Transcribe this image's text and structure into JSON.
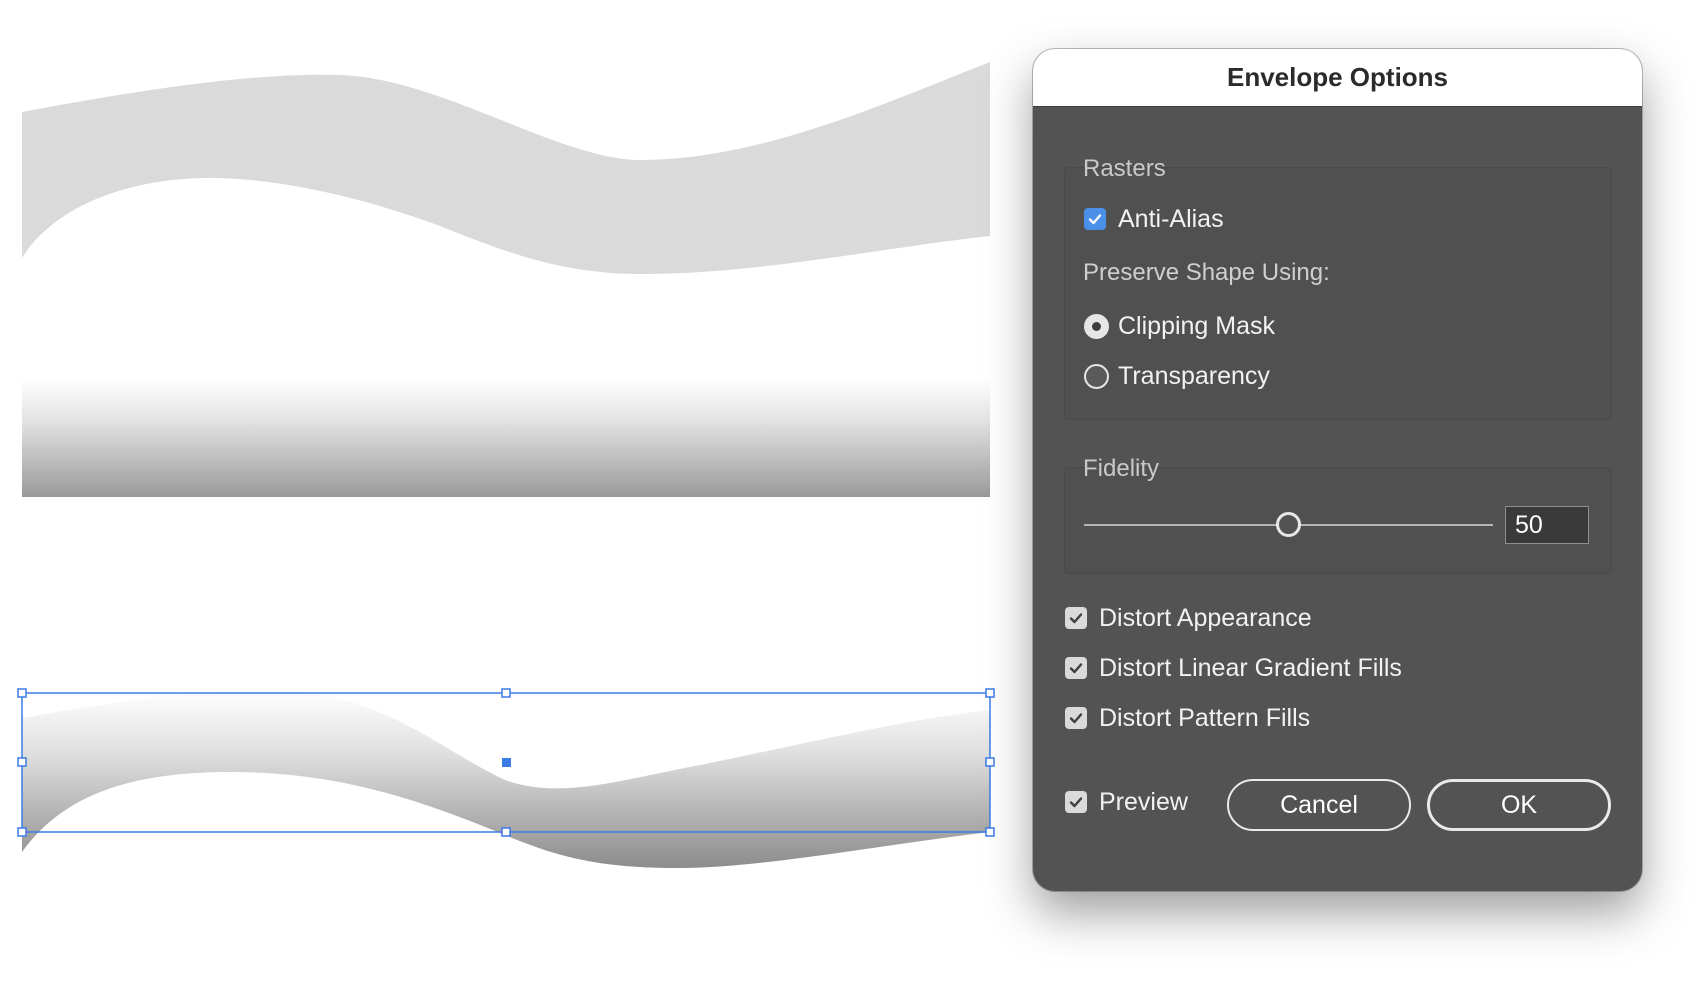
{
  "dialog": {
    "title": "Envelope Options",
    "rasters": {
      "label": "Rasters",
      "anti_alias": {
        "label": "Anti-Alias",
        "checked": true
      },
      "preserve_shape_label": "Preserve Shape Using:",
      "options": [
        {
          "label": "Clipping Mask",
          "selected": true
        },
        {
          "label": "Transparency",
          "selected": false
        }
      ]
    },
    "fidelity": {
      "label": "Fidelity",
      "value": "50",
      "slider_fraction": 0.5
    },
    "checkboxes": {
      "distort_appearance": {
        "label": "Distort Appearance",
        "checked": true
      },
      "distort_linear_gradient_fills": {
        "label": "Distort Linear Gradient Fills",
        "checked": true
      },
      "distort_pattern_fills": {
        "label": "Distort Pattern Fills",
        "checked": true
      },
      "preview": {
        "label": "Preview",
        "checked": true
      }
    },
    "buttons": {
      "cancel": "Cancel",
      "ok": "OK"
    }
  },
  "colors": {
    "dialog_bg": "#535353",
    "checkbox_accent": "#4a90e8",
    "selection_blue": "#3d7be6",
    "wave_fill": "#dadada"
  }
}
